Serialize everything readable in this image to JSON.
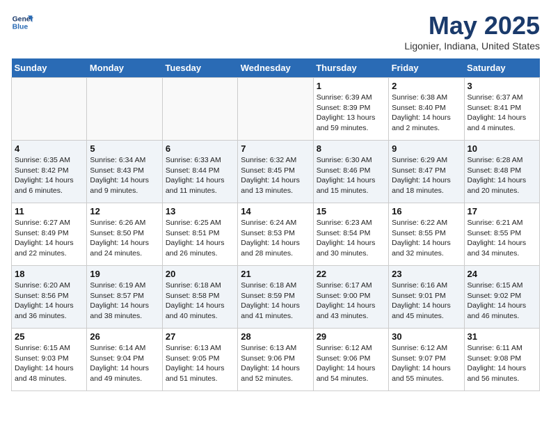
{
  "header": {
    "logo_line1": "General",
    "logo_line2": "Blue",
    "month": "May 2025",
    "location": "Ligonier, Indiana, United States"
  },
  "weekdays": [
    "Sunday",
    "Monday",
    "Tuesday",
    "Wednesday",
    "Thursday",
    "Friday",
    "Saturday"
  ],
  "weeks": [
    [
      {
        "date": "",
        "text": ""
      },
      {
        "date": "",
        "text": ""
      },
      {
        "date": "",
        "text": ""
      },
      {
        "date": "",
        "text": ""
      },
      {
        "date": "1",
        "text": "Sunrise: 6:39 AM\nSunset: 8:39 PM\nDaylight: 13 hours and 59 minutes."
      },
      {
        "date": "2",
        "text": "Sunrise: 6:38 AM\nSunset: 8:40 PM\nDaylight: 14 hours and 2 minutes."
      },
      {
        "date": "3",
        "text": "Sunrise: 6:37 AM\nSunset: 8:41 PM\nDaylight: 14 hours and 4 minutes."
      }
    ],
    [
      {
        "date": "4",
        "text": "Sunrise: 6:35 AM\nSunset: 8:42 PM\nDaylight: 14 hours and 6 minutes."
      },
      {
        "date": "5",
        "text": "Sunrise: 6:34 AM\nSunset: 8:43 PM\nDaylight: 14 hours and 9 minutes."
      },
      {
        "date": "6",
        "text": "Sunrise: 6:33 AM\nSunset: 8:44 PM\nDaylight: 14 hours and 11 minutes."
      },
      {
        "date": "7",
        "text": "Sunrise: 6:32 AM\nSunset: 8:45 PM\nDaylight: 14 hours and 13 minutes."
      },
      {
        "date": "8",
        "text": "Sunrise: 6:30 AM\nSunset: 8:46 PM\nDaylight: 14 hours and 15 minutes."
      },
      {
        "date": "9",
        "text": "Sunrise: 6:29 AM\nSunset: 8:47 PM\nDaylight: 14 hours and 18 minutes."
      },
      {
        "date": "10",
        "text": "Sunrise: 6:28 AM\nSunset: 8:48 PM\nDaylight: 14 hours and 20 minutes."
      }
    ],
    [
      {
        "date": "11",
        "text": "Sunrise: 6:27 AM\nSunset: 8:49 PM\nDaylight: 14 hours and 22 minutes."
      },
      {
        "date": "12",
        "text": "Sunrise: 6:26 AM\nSunset: 8:50 PM\nDaylight: 14 hours and 24 minutes."
      },
      {
        "date": "13",
        "text": "Sunrise: 6:25 AM\nSunset: 8:51 PM\nDaylight: 14 hours and 26 minutes."
      },
      {
        "date": "14",
        "text": "Sunrise: 6:24 AM\nSunset: 8:53 PM\nDaylight: 14 hours and 28 minutes."
      },
      {
        "date": "15",
        "text": "Sunrise: 6:23 AM\nSunset: 8:54 PM\nDaylight: 14 hours and 30 minutes."
      },
      {
        "date": "16",
        "text": "Sunrise: 6:22 AM\nSunset: 8:55 PM\nDaylight: 14 hours and 32 minutes."
      },
      {
        "date": "17",
        "text": "Sunrise: 6:21 AM\nSunset: 8:55 PM\nDaylight: 14 hours and 34 minutes."
      }
    ],
    [
      {
        "date": "18",
        "text": "Sunrise: 6:20 AM\nSunset: 8:56 PM\nDaylight: 14 hours and 36 minutes."
      },
      {
        "date": "19",
        "text": "Sunrise: 6:19 AM\nSunset: 8:57 PM\nDaylight: 14 hours and 38 minutes."
      },
      {
        "date": "20",
        "text": "Sunrise: 6:18 AM\nSunset: 8:58 PM\nDaylight: 14 hours and 40 minutes."
      },
      {
        "date": "21",
        "text": "Sunrise: 6:18 AM\nSunset: 8:59 PM\nDaylight: 14 hours and 41 minutes."
      },
      {
        "date": "22",
        "text": "Sunrise: 6:17 AM\nSunset: 9:00 PM\nDaylight: 14 hours and 43 minutes."
      },
      {
        "date": "23",
        "text": "Sunrise: 6:16 AM\nSunset: 9:01 PM\nDaylight: 14 hours and 45 minutes."
      },
      {
        "date": "24",
        "text": "Sunrise: 6:15 AM\nSunset: 9:02 PM\nDaylight: 14 hours and 46 minutes."
      }
    ],
    [
      {
        "date": "25",
        "text": "Sunrise: 6:15 AM\nSunset: 9:03 PM\nDaylight: 14 hours and 48 minutes."
      },
      {
        "date": "26",
        "text": "Sunrise: 6:14 AM\nSunset: 9:04 PM\nDaylight: 14 hours and 49 minutes."
      },
      {
        "date": "27",
        "text": "Sunrise: 6:13 AM\nSunset: 9:05 PM\nDaylight: 14 hours and 51 minutes."
      },
      {
        "date": "28",
        "text": "Sunrise: 6:13 AM\nSunset: 9:06 PM\nDaylight: 14 hours and 52 minutes."
      },
      {
        "date": "29",
        "text": "Sunrise: 6:12 AM\nSunset: 9:06 PM\nDaylight: 14 hours and 54 minutes."
      },
      {
        "date": "30",
        "text": "Sunrise: 6:12 AM\nSunset: 9:07 PM\nDaylight: 14 hours and 55 minutes."
      },
      {
        "date": "31",
        "text": "Sunrise: 6:11 AM\nSunset: 9:08 PM\nDaylight: 14 hours and 56 minutes."
      }
    ]
  ]
}
